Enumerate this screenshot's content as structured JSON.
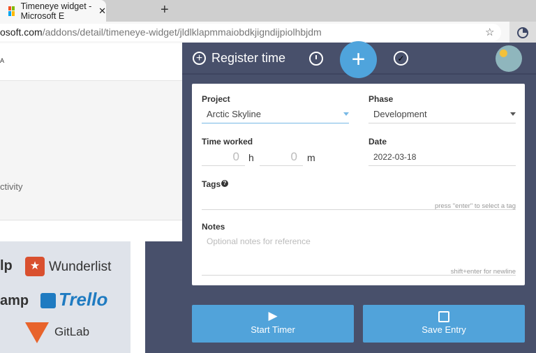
{
  "browser": {
    "tab_title": "Timeneye widget - Microsoft E",
    "new_tab": "+",
    "close": "✕",
    "url_host": "osoft.com",
    "url_path": "/addons/detail/timeneye-widget/jldlklapmmaiobdkjigndijpiolhbjdm"
  },
  "background_page": {
    "header_text": "A",
    "activity_text": "ctivity",
    "logos": [
      "lp",
      "Wunderlist",
      "amp",
      "Trello",
      "GitLab"
    ]
  },
  "widget": {
    "header": {
      "title": "Register time",
      "add": "+"
    },
    "project": {
      "label": "Project",
      "value": "Arctic Skyline"
    },
    "phase": {
      "label": "Phase",
      "value": "Development"
    },
    "time": {
      "label": "Time worked",
      "hours": "0",
      "hours_unit": "h",
      "minutes": "0",
      "minutes_unit": "m"
    },
    "date": {
      "label": "Date",
      "value": "2022-03-18"
    },
    "tags": {
      "label": "Tags",
      "help": "?",
      "hint": "press \"enter\" to select a tag"
    },
    "notes": {
      "label": "Notes",
      "placeholder": "Optional notes for reference",
      "hint": "shift+enter for newline"
    },
    "start_timer": "Start Timer",
    "save_entry": "Save Entry",
    "accent": "#51a3da",
    "bg": "#48506b"
  }
}
